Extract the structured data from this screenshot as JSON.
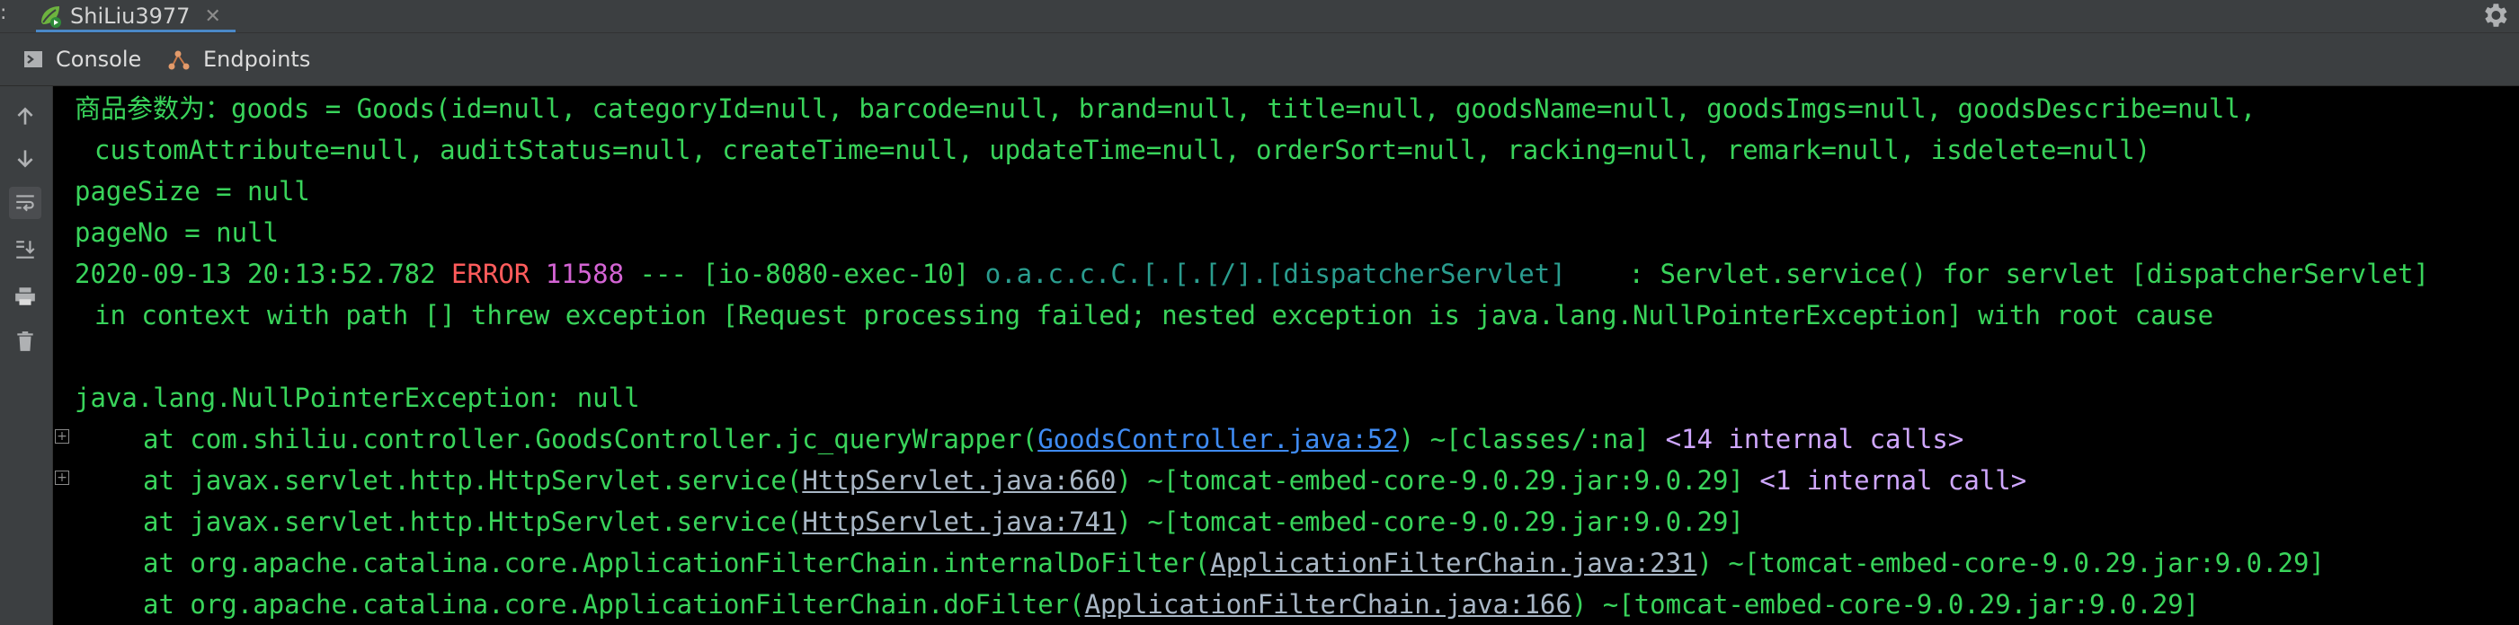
{
  "header": {
    "left_mark": ":",
    "run_tab_label": "ShiLiu3977"
  },
  "subtabs": {
    "console_label": "Console",
    "endpoints_label": "Endpoints"
  },
  "icons": {
    "run": "spring-run-icon",
    "settings": "gear-icon",
    "console": "console-icon",
    "endpoints": "endpoints-icon",
    "up": "arrow-up-icon",
    "down": "arrow-down-icon",
    "wrap": "soft-wrap-icon",
    "scroll": "scroll-to-end-icon",
    "print": "print-icon",
    "clear": "trash-icon"
  },
  "colors": {
    "console_bg": "#000000",
    "default_text": "#39d45b",
    "error": "#ff5c5c",
    "pid": "#d464d4",
    "logger": "#2a9d8f",
    "link": "#3f8bf2",
    "internal_calls": "#cfa7ff"
  },
  "console": {
    "l1": "商品参数为：goods = Goods(id=null, categoryId=null, barcode=null, brand=null, title=null, goodsName=null, goodsImgs=null, goodsDescribe=null,",
    "l2": "customAttribute=null, auditStatus=null, createTime=null, updateTime=null, orderSort=null, racking=null, remark=null, isdelete=null)",
    "l3": "pageSize = null",
    "l4": "pageNo = null",
    "l5_time": "2020-09-13 20:13:52.782 ",
    "l5_level": "ERROR",
    "l5_pid": " 11588",
    "l5_thread": " --- [io-8080-exec-10] ",
    "l5_logger": "o.a.c.c.C.[.[.[/].[dispatcherServlet]",
    "l5_msg": "    : Servlet.service() for servlet [dispatcherServlet]",
    "l6": "in context with path [] threw exception [Request processing failed; nested exception is java.lang.NullPointerException] with root cause",
    "l7": "java.lang.NullPointerException: null",
    "s1_pre": "at com.shiliu.controller.GoodsController.jc_queryWrapper(",
    "s1_link": "GoodsController.java:52",
    "s1_post": ") ~[classes/:na] ",
    "s1_internal": "<14 internal calls>",
    "s2_pre": "at javax.servlet.http.HttpServlet.service(",
    "s2_link": "HttpServlet.java:660",
    "s2_post": ") ~[tomcat-embed-core-9.0.29.jar:9.0.29] ",
    "s2_internal": "<1 internal call>",
    "s3_pre": "at javax.servlet.http.HttpServlet.service(",
    "s3_link": "HttpServlet.java:741",
    "s3_post": ") ~[tomcat-embed-core-9.0.29.jar:9.0.29]",
    "s4_pre": "at org.apache.catalina.core.ApplicationFilterChain.internalDoFilter(",
    "s4_link": "ApplicationFilterChain.java:231",
    "s4_post": ") ~[tomcat-embed-core-9.0.29.jar:9.0.29]",
    "s5_pre": "at org.apache.catalina.core.ApplicationFilterChain.doFilter(",
    "s5_link": "ApplicationFilterChain.java:166",
    "s5_post": ") ~[tomcat-embed-core-9.0.29.jar:9.0.29]",
    "expander_symbol": "+"
  }
}
